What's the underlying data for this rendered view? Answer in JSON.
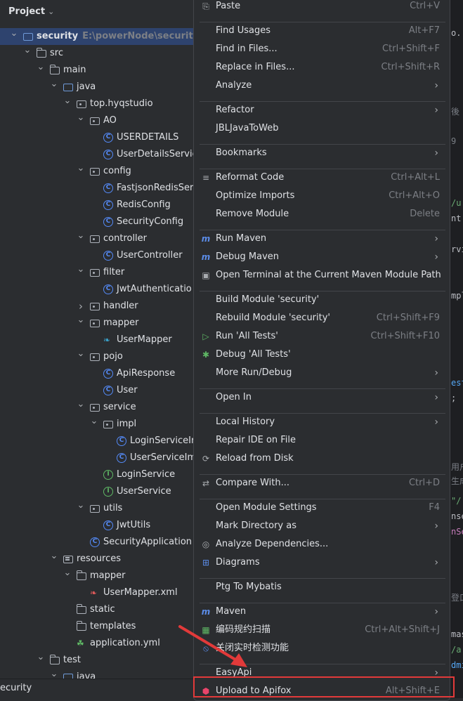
{
  "project": {
    "title": "Project",
    "tree": [
      {
        "label": "security",
        "hint": "E:\\powerNode\\security",
        "icon": "module-folder-icon",
        "depth": 0,
        "arrow": "down",
        "bold": true,
        "selected": true
      },
      {
        "label": "src",
        "icon": "folder-icon",
        "depth": 1,
        "arrow": "down"
      },
      {
        "label": "main",
        "icon": "folder-icon",
        "depth": 2,
        "arrow": "down"
      },
      {
        "label": "java",
        "icon": "source-folder-icon",
        "depth": 3,
        "arrow": "down"
      },
      {
        "label": "top.hyqstudio",
        "icon": "package-icon",
        "depth": 4,
        "arrow": "down"
      },
      {
        "label": "AO",
        "icon": "package-icon",
        "depth": 5,
        "arrow": "down"
      },
      {
        "label": "USERDETAILS",
        "icon": "class-icon",
        "depth": 6
      },
      {
        "label": "UserDetailsServic",
        "icon": "class-icon",
        "depth": 6
      },
      {
        "label": "config",
        "icon": "package-icon",
        "depth": 5,
        "arrow": "down"
      },
      {
        "label": "FastjsonRedisSer",
        "icon": "class-icon",
        "depth": 6
      },
      {
        "label": "RedisConfig",
        "icon": "class-icon",
        "depth": 6
      },
      {
        "label": "SecurityConfig",
        "icon": "class-icon",
        "depth": 6
      },
      {
        "label": "controller",
        "icon": "package-icon",
        "depth": 5,
        "arrow": "down"
      },
      {
        "label": "UserController",
        "icon": "class-icon",
        "depth": 6
      },
      {
        "label": "filter",
        "icon": "package-icon",
        "depth": 5,
        "arrow": "down"
      },
      {
        "label": "JwtAuthenticatio",
        "icon": "class-icon",
        "depth": 6
      },
      {
        "label": "handler",
        "icon": "package-icon",
        "depth": 5,
        "arrow": "right"
      },
      {
        "label": "mapper",
        "icon": "package-icon",
        "depth": 5,
        "arrow": "down"
      },
      {
        "label": "UserMapper",
        "icon": "mybatis-icon",
        "depth": 6
      },
      {
        "label": "pojo",
        "icon": "package-icon",
        "depth": 5,
        "arrow": "down"
      },
      {
        "label": "ApiResponse",
        "icon": "class-icon",
        "depth": 6
      },
      {
        "label": "User",
        "icon": "class-icon",
        "depth": 6
      },
      {
        "label": "service",
        "icon": "package-icon",
        "depth": 5,
        "arrow": "down"
      },
      {
        "label": "impl",
        "icon": "package-icon",
        "depth": 6,
        "arrow": "down"
      },
      {
        "label": "LoginServiceIr",
        "icon": "class-icon",
        "depth": 7
      },
      {
        "label": "UserServiceIm",
        "icon": "class-icon",
        "depth": 7
      },
      {
        "label": "LoginService",
        "icon": "interface-icon",
        "depth": 6
      },
      {
        "label": "UserService",
        "icon": "interface-icon",
        "depth": 6
      },
      {
        "label": "utils",
        "icon": "package-icon",
        "depth": 5,
        "arrow": "down"
      },
      {
        "label": "JwtUtils",
        "icon": "class-icon",
        "depth": 6
      },
      {
        "label": "SecurityApplication",
        "icon": "spring-app-icon",
        "depth": 5
      },
      {
        "label": "resources",
        "icon": "resources-folder-icon",
        "depth": 3,
        "arrow": "down"
      },
      {
        "label": "mapper",
        "icon": "folder-icon",
        "depth": 4,
        "arrow": "down"
      },
      {
        "label": "UserMapper.xml",
        "icon": "xml-icon",
        "depth": 5
      },
      {
        "label": "static",
        "icon": "folder-icon",
        "depth": 4
      },
      {
        "label": "templates",
        "icon": "folder-icon",
        "depth": 4
      },
      {
        "label": "application.yml",
        "icon": "yml-icon",
        "depth": 4
      },
      {
        "label": "test",
        "icon": "folder-icon",
        "depth": 2,
        "arrow": "down"
      },
      {
        "label": "java",
        "icon": "source-folder-icon",
        "depth": 3,
        "arrow": "down"
      }
    ],
    "status": "ecurity"
  },
  "editor": {
    "fragments": [
      {
        "text": "o.",
        "color": "#bcbec4"
      },
      {
        "text": "後",
        "color": "#7a7e85"
      },
      {
        "text": "9",
        "color": "#7a7e85"
      },
      {
        "text": "/u",
        "color": "#6aab73"
      },
      {
        "text": "nt",
        "color": "#bcbec4"
      },
      {
        "text": "rvi",
        "color": "#bcbec4"
      },
      {
        "text": "mpl",
        "color": "#bcbec4"
      },
      {
        "text": "est",
        "color": "#56a8f5"
      },
      {
        "text": ";",
        "color": "#bcbec4"
      },
      {
        "text": "用户",
        "color": "#7a7e85"
      },
      {
        "text": "生成",
        "color": "#7a7e85"
      },
      {
        "text": "\"/",
        "color": "#6aab73"
      },
      {
        "text": "nse",
        "color": "#bcbec4"
      },
      {
        "text": "nSe",
        "color": "#c77dbb"
      },
      {
        "text": "登口",
        "color": "#7a7e85"
      },
      {
        "text": "mas",
        "color": "#bcbec4"
      },
      {
        "text": "/a",
        "color": "#6aab73"
      },
      {
        "text": "dmi",
        "color": "#56a8f5"
      }
    ]
  },
  "menu": {
    "items": [
      {
        "label": "Paste",
        "u": "P",
        "shortcut": "Ctrl+V",
        "icon": "paste-icon"
      },
      {
        "sep": true
      },
      {
        "label": "Find Usages",
        "shortcut": "Alt+F7"
      },
      {
        "label": "Find in Files...",
        "shortcut": "Ctrl+Shift+F"
      },
      {
        "label": "Replace in Files...",
        "shortcut": "Ctrl+Shift+R"
      },
      {
        "label": "Analyze",
        "submenu": true
      },
      {
        "sep": true
      },
      {
        "label": "Refactor",
        "u": "R",
        "submenu": true
      },
      {
        "label": "JBLJavaToWeb"
      },
      {
        "sep": true
      },
      {
        "label": "Bookmarks",
        "submenu": true
      },
      {
        "sep": true
      },
      {
        "label": "Reformat Code",
        "shortcut": "Ctrl+Alt+L",
        "icon": "reformat-icon"
      },
      {
        "label": "Optimize Imports",
        "shortcut": "Ctrl+Alt+O"
      },
      {
        "label": "Remove Module",
        "shortcut": "Delete"
      },
      {
        "sep": true
      },
      {
        "label": "Run Maven",
        "submenu": true,
        "icon": "maven-run-icon"
      },
      {
        "label": "Debug Maven",
        "submenu": true,
        "icon": "maven-debug-icon"
      },
      {
        "label": "Open Terminal at the Current Maven Module Path",
        "icon": "terminal-icon"
      },
      {
        "sep": true
      },
      {
        "label": "Build Module 'security'"
      },
      {
        "label": "Rebuild Module 'security'",
        "shortcut": "Ctrl+Shift+F9"
      },
      {
        "label": "Run 'All Tests'",
        "shortcut": "Ctrl+Shift+F10",
        "icon": "run-icon"
      },
      {
        "label": "Debug 'All Tests'",
        "icon": "debug-icon"
      },
      {
        "label": "More Run/Debug",
        "submenu": true
      },
      {
        "sep": true
      },
      {
        "label": "Open In",
        "submenu": true
      },
      {
        "sep": true
      },
      {
        "label": "Local History",
        "submenu": true
      },
      {
        "label": "Repair IDE on File"
      },
      {
        "label": "Reload from Disk",
        "icon": "reload-icon"
      },
      {
        "sep": true
      },
      {
        "label": "Compare With...",
        "shortcut": "Ctrl+D",
        "icon": "compare-icon"
      },
      {
        "sep": true
      },
      {
        "label": "Open Module Settings",
        "shortcut": "F4"
      },
      {
        "label": "Mark Directory as",
        "submenu": true
      },
      {
        "label": "Analyze Dependencies...",
        "icon": "dependencies-icon"
      },
      {
        "label": "Diagrams",
        "submenu": true,
        "icon": "diagram-icon"
      },
      {
        "sep": true
      },
      {
        "label": "Ptg To Mybatis"
      },
      {
        "sep": true
      },
      {
        "label": "Maven",
        "submenu": true,
        "icon": "maven-icon"
      },
      {
        "label": "编码规约扫描",
        "shortcut": "Ctrl+Alt+Shift+J",
        "icon": "code-scan-icon"
      },
      {
        "label": "关闭实时检测功能",
        "icon": "realtime-detect-icon"
      },
      {
        "sep": true
      },
      {
        "label": "EasyApi",
        "submenu": true
      },
      {
        "label": "Upload to Apifox",
        "shortcut": "Alt+Shift+E",
        "icon": "apifox-icon"
      }
    ]
  },
  "colors": {
    "accent": "#2e436e",
    "highlight": "#e23a3a"
  }
}
